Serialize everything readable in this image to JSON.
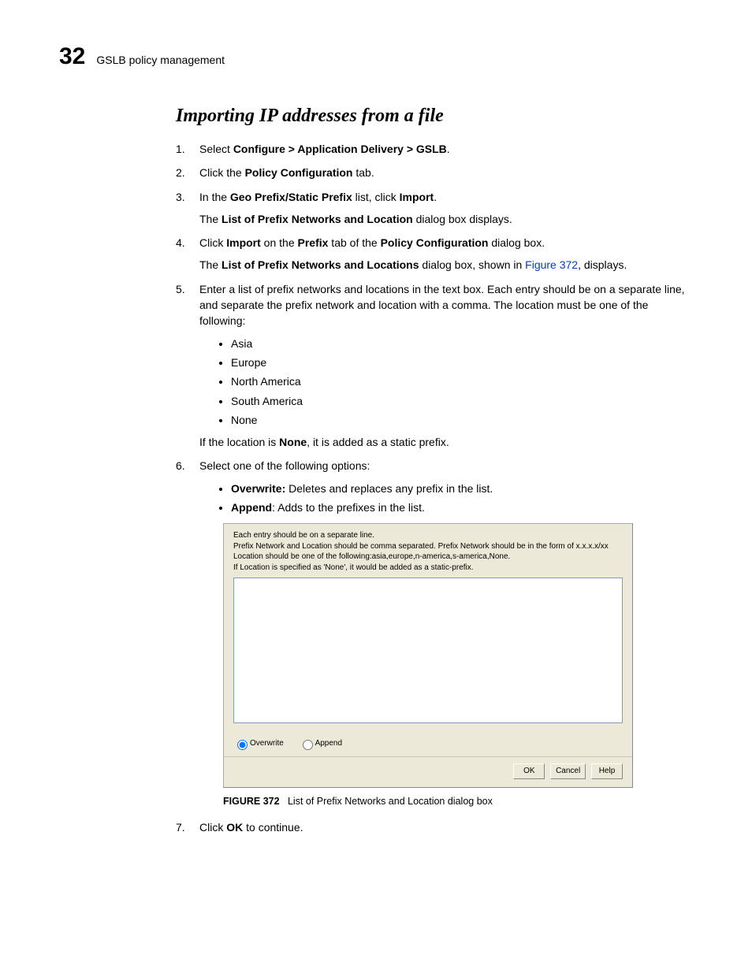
{
  "header": {
    "chapter_number": "32",
    "chapter_title": "GSLB policy management"
  },
  "section": {
    "title": "Importing IP addresses from a file"
  },
  "steps": {
    "s1a": "Select ",
    "s1b": "Configure > Application Delivery > GSLB",
    "s1c": ".",
    "s2a": "Click the ",
    "s2b": "Policy Configuration",
    "s2c": " tab.",
    "s3a": "In the ",
    "s3b": "Geo Prefix/Static Prefix",
    "s3c": " list, click ",
    "s3d": "Import",
    "s3e": ".",
    "s3f": "The ",
    "s3g": "List of Prefix Networks and Location",
    "s3h": " dialog box displays.",
    "s4a": "Click ",
    "s4b": "Import",
    "s4c": " on the ",
    "s4d": "Prefix",
    "s4e": " tab of the ",
    "s4f": "Policy Configuration",
    "s4g": " dialog box.",
    "s4h": "The ",
    "s4i": "List of Prefix Networks and Locations",
    "s4j": " dialog box, shown in ",
    "s4k": "Figure 372",
    "s4l": ", displays.",
    "s5": "Enter a list of prefix networks and locations in the text box. Each entry should be on a separate line, and separate the prefix network and location with a comma. The location must be one of the following:",
    "s5b": [
      "Asia",
      "Europe",
      "North America",
      "South America",
      "None"
    ],
    "s5c1": "If the location is ",
    "s5c2": "None",
    "s5c3": ", it is added as a static prefix.",
    "s6": "Select one of the following options:",
    "s6o1a": "Overwrite:",
    "s6o1b": " Deletes and replaces any prefix in the list.",
    "s6o2a": "Append",
    "s6o2b": ": Adds to the prefixes in the list.",
    "s7a": "Click ",
    "s7b": "OK",
    "s7c": " to continue."
  },
  "dialog": {
    "instr1": "Each entry should be on a separate line.",
    "instr2": "Prefix Network and Location should be comma separated. Prefix Network should be in the form of x.x.x.x/xx",
    "instr3": "Location should be one of the following:asia,europe,n-america,s-america,None.",
    "instr4": "If Location is specified as 'None', it would be added as a static-prefix.",
    "radio_overwrite": "Overwrite",
    "radio_append": "Append",
    "btn_ok": "OK",
    "btn_cancel": "Cancel",
    "btn_help": "Help"
  },
  "figure": {
    "label": "FIGURE 372",
    "caption": "List of Prefix Networks and Location dialog box"
  }
}
